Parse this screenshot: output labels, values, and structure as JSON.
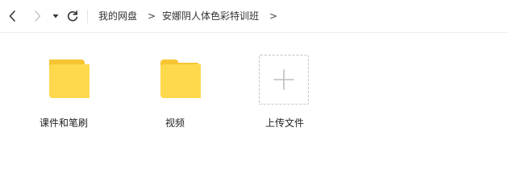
{
  "toolbar": {
    "back_icon": "chevron-left-icon",
    "forward_icon": "chevron-right-icon",
    "history_icon": "caret-down-icon",
    "refresh_icon": "refresh-icon"
  },
  "breadcrumb": {
    "items": [
      {
        "label": "我的网盘"
      },
      {
        "label": "安娜阴人体色彩特训班"
      }
    ],
    "separator": ">"
  },
  "files": [
    {
      "name": "课件和笔刷",
      "type": "folder",
      "icon": "folder-icon"
    },
    {
      "name": "视频",
      "type": "folder",
      "icon": "folder-icon"
    }
  ],
  "upload": {
    "label": "上传文件",
    "icon": "plus-icon"
  },
  "colors": {
    "folder_body": "#FFD94D",
    "folder_tab": "#F7C531",
    "disabled_icon": "#c8c8c8",
    "active_icon": "#333333"
  }
}
